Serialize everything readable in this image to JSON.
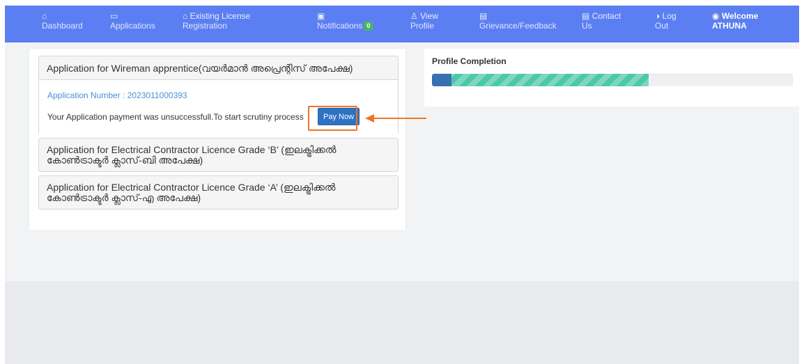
{
  "nav": {
    "items": [
      {
        "icon": "home-icon",
        "glyph": "⌂",
        "line1": "Dashboard"
      },
      {
        "icon": "copy-icon",
        "glyph": "▭",
        "line1": "Applications"
      },
      {
        "icon": "home-icon",
        "glyph": "⌂",
        "line1": "Existing License",
        "line2": "Registration"
      },
      {
        "icon": "bell-icon",
        "glyph": "▣",
        "line1": "Notifications",
        "badge": "0"
      },
      {
        "icon": "user-icon",
        "glyph": "♙",
        "line1": "View",
        "line2": "Profile"
      },
      {
        "icon": "document-icon",
        "glyph": "▤",
        "line1": "Grievance/Feedback"
      },
      {
        "icon": "document-icon",
        "glyph": "▤",
        "line1": "Contact",
        "line2": "Us"
      },
      {
        "icon": "power-icon",
        "glyph": "◑",
        "line1": "Log",
        "line2": "Out"
      },
      {
        "icon": "user-circle-icon",
        "glyph": "◉",
        "line1": "Welcome",
        "line2": "ATHUNA"
      }
    ]
  },
  "applications": {
    "wireman": {
      "title": "Application for Wireman apprentice(വയർമാൻ അപ്രെന്റിസ് അപേക്ഷ)",
      "number_label": "Application Number : 2023011000393",
      "message": "Your Application payment was unsuccessfull.To start scrutiny process",
      "pay_button": "Pay Now"
    },
    "grade_b": {
      "title_line1": "Application for Electrical Contractor Licence Grade ‘B’ (ഇലക്ട്രിക്കൽ",
      "title_line2": "കോൺട്രാക്ടർ ക്ലാസ്-ബി അപേക്ഷ)"
    },
    "grade_a": {
      "title_line1": "Application for Electrical Contractor Licence Grade ‘A’ (ഇലക്ട്രിക്കൽ",
      "title_line2": "കോൺട്രാക്ടർ ക്ലാസ്-എ അപേക്ഷ)"
    }
  },
  "profile": {
    "title": "Profile Completion",
    "progress_fraction": 0.6
  },
  "colors": {
    "nav_bg": "#5b7ff2",
    "highlight": "#ee7424",
    "progress_dark": "#3b6fb3",
    "progress_light": "#4cc8a8"
  }
}
